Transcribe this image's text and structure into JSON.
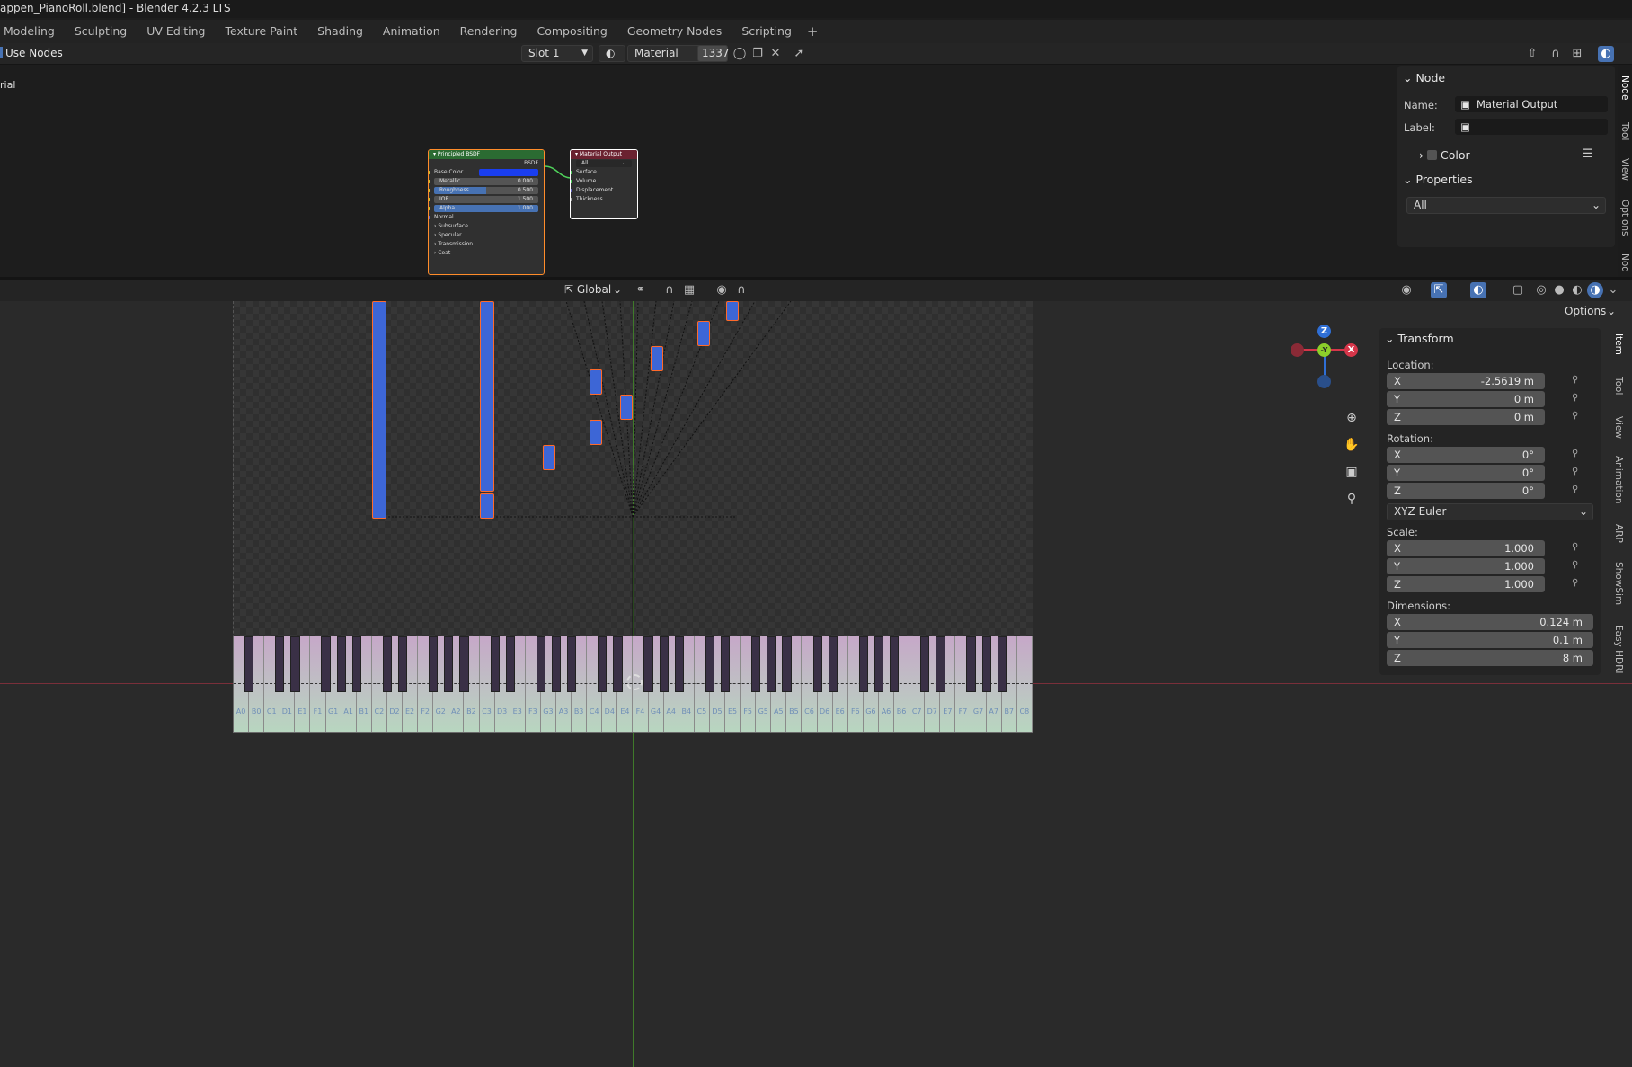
{
  "window": {
    "title": "appen_PianoRoll.blend] - Blender 4.2.3 LTS"
  },
  "workspaces": [
    "Modeling",
    "Sculpting",
    "UV Editing",
    "Texture Paint",
    "Shading",
    "Animation",
    "Rendering",
    "Compositing",
    "Geometry Nodes",
    "Scripting"
  ],
  "workspace_add": "+",
  "node_header": {
    "use_nodes": "Use Nodes",
    "slot": "Slot 1",
    "material_name": "Material",
    "user_count": "1337",
    "editor_label": "rial"
  },
  "nodes": {
    "bsdf": {
      "title": "Principled BSDF",
      "output": "BSDF",
      "base_color": "Base Color",
      "base_color_hex": "#1a3ef0",
      "metallic": {
        "label": "Metallic",
        "value": "0.000"
      },
      "roughness": {
        "label": "Roughness",
        "value": "0.500"
      },
      "ior": {
        "label": "IOR",
        "value": "1.500"
      },
      "alpha": {
        "label": "Alpha",
        "value": "1.000"
      },
      "normal": "Normal",
      "subsurface": "Subsurface",
      "specular": "Specular",
      "transmission": "Transmission",
      "coat": "Coat"
    },
    "output": {
      "title": "Material Output",
      "target": "All",
      "surface": "Surface",
      "volume": "Volume",
      "displacement": "Displacement",
      "thickness": "Thickness"
    }
  },
  "node_panel": {
    "section": "Node",
    "name_label": "Name:",
    "name_value": "Material Output",
    "label_label": "Label:",
    "label_value": "",
    "color": "Color",
    "properties": "Properties",
    "properties_value": "All"
  },
  "node_side_tabs": [
    "Node",
    "Tool",
    "View",
    "Options",
    "Nod"
  ],
  "viewport_header": {
    "orientation": "Global",
    "options": "Options"
  },
  "transform": {
    "section": "Transform",
    "location_label": "Location:",
    "location": {
      "x": "-2.5619 m",
      "y": "0 m",
      "z": "0 m"
    },
    "rotation_label": "Rotation:",
    "rotation": {
      "x": "0°",
      "y": "0°",
      "z": "0°"
    },
    "rotation_mode": "XYZ Euler",
    "scale_label": "Scale:",
    "scale": {
      "x": "1.000",
      "y": "1.000",
      "z": "1.000"
    },
    "dimensions_label": "Dimensions:",
    "dimensions": {
      "x": "0.124 m",
      "y": "0.1 m",
      "z": "8 m"
    },
    "axes": {
      "x": "X",
      "y": "Y",
      "z": "Z"
    }
  },
  "viewport_side_tabs": [
    "Item",
    "Tool",
    "View",
    "Animation",
    "ARP",
    "ShowSim",
    "Easy HDRI"
  ],
  "gizmo": {
    "x": "X",
    "y": "-Y",
    "z": "Z"
  },
  "keyboard_labels": [
    "A0",
    "B0",
    "C1",
    "D1",
    "E1",
    "F1",
    "G1",
    "A1",
    "B1",
    "C2",
    "D2",
    "E2",
    "F2",
    "G2",
    "A2",
    "B2",
    "C3",
    "D3",
    "E3",
    "F3",
    "G3",
    "A3",
    "B3",
    "C4",
    "D4",
    "E4",
    "F4",
    "G4",
    "A4",
    "B4",
    "C5",
    "D5",
    "E5",
    "F5",
    "G5",
    "A5",
    "B5",
    "C6",
    "D6",
    "E6",
    "F6",
    "G6",
    "A6",
    "B6",
    "C7",
    "D7",
    "E7",
    "F7",
    "G7",
    "A7",
    "B7",
    "C8"
  ],
  "colors": {
    "accent": "#4772b3",
    "note_fill": "#3d66d6",
    "note_outline": "#ff6a2a"
  }
}
